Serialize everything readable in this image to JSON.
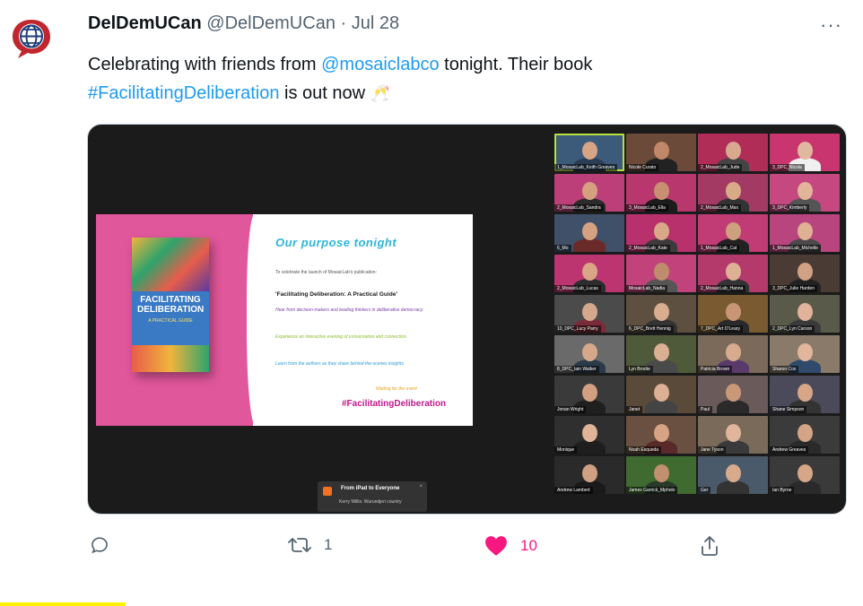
{
  "tweet": {
    "display_name": "DelDemUCan",
    "handle": "@DelDemUCan",
    "separator": "·",
    "date": "Jul 28",
    "more_label": "···",
    "text_1": "Celebrating with friends from ",
    "mention": "@mosaiclabco",
    "text_2": " tonight. Their book",
    "hashtag": "#FacilitatingDeliberation",
    "text_3": " is out now ",
    "emoji": "🥂"
  },
  "avatar": {
    "icon": "globe-speech-bubble-icon",
    "color": "#c0262e"
  },
  "media": {
    "slide": {
      "title": "Our purpose tonight",
      "line_1": "To celebrate the launch of MosaicLab's publication:",
      "main": "'Facilitating Deliberation: A Practical Guide'",
      "line_2": "Hear from decision-makers and leading thinkers in deliberative democracy.",
      "line_3": "Experience an interactive evening of conversation and connection.",
      "line_4": "Learn from the authors as they share behind-the-scenes insights.",
      "waiting": "Waiting for the event",
      "hashtag": "#FacilitatingDeliberation",
      "book_title": "FACILITATING DELIBERATION",
      "book_subtitle": "A PRACTICAL GUIDE"
    },
    "participants": [
      {
        "label": "1_MosaicLab_Keith Greaves",
        "bg": "#3c5a7a",
        "skin": "#d7a486",
        "shirt": "#2a3d55"
      },
      {
        "label": "Nicole Curato",
        "bg": "#6b4a3a",
        "skin": "#c08868",
        "shirt": "#222222"
      },
      {
        "label": "2_MosaicLab_Jude",
        "bg": "#b02d58",
        "skin": "#d8a890",
        "shirt": "#444444"
      },
      {
        "label": "3_DPC_Nicola",
        "bg": "#c9356e",
        "skin": "#e0b8a0",
        "shirt": "#f0f0f0"
      },
      {
        "label": "2_MosaicLab_Sandra",
        "bg": "#bd3f7a",
        "skin": "#d6a080",
        "shirt": "#2b2b2b"
      },
      {
        "label": "3_MosaicLab_Ella",
        "bg": "#b8386e",
        "skin": "#c98f72",
        "shirt": "#1c1c1c"
      },
      {
        "label": "2_MosaicLab_Max",
        "bg": "#a33a63",
        "skin": "#d9aa88",
        "shirt": "#333333"
      },
      {
        "label": "3_DPC_Kimberly",
        "bg": "#c64880",
        "skin": "#e2b49a",
        "shirt": "#555555"
      },
      {
        "label": "6_Mo",
        "bg": "#3f5068",
        "skin": "#d4a283",
        "shirt": "#6b2a2a"
      },
      {
        "label": "2_MosaicLab_Kate",
        "bg": "#b9316c",
        "skin": "#d8a888",
        "shirt": "#3b3b3b"
      },
      {
        "label": "1_MosaicLab_Cat",
        "bg": "#c13b75",
        "skin": "#cfa080",
        "shirt": "#222222"
      },
      {
        "label": "1_MosaicLab_Michelle",
        "bg": "#b8457e",
        "skin": "#e0b095",
        "shirt": "#4a4a4a"
      },
      {
        "label": "2_MosaicLab_Lucas",
        "bg": "#bc3571",
        "skin": "#d9a586",
        "shirt": "#2d2d2d"
      },
      {
        "label": "MosaicLab_Nadia",
        "bg": "#c2437b",
        "skin": "#c08c6e",
        "shirt": "#555555"
      },
      {
        "label": "2_MosaicLab_Hanna",
        "bg": "#b33a6a",
        "skin": "#deb197",
        "shirt": "#333333"
      },
      {
        "label": "3_DPC_Julie Harden",
        "bg": "#4a3b34",
        "skin": "#d1a184",
        "shirt": "#222222"
      },
      {
        "label": "10_DPC_Lucy Parry",
        "bg": "#4b4b4b",
        "skin": "#d4a88c",
        "shirt": "#7a2b3a"
      },
      {
        "label": "6_DPC_Brett Hennig",
        "bg": "#5e5040",
        "skin": "#d9ad90",
        "shirt": "#333333"
      },
      {
        "label": "7_DPC_Art O'Leary",
        "bg": "#7a5a30",
        "skin": "#c89676",
        "shirt": "#2a2a2a"
      },
      {
        "label": "2_DPC_Lyn Carson",
        "bg": "#5a5a4a",
        "skin": "#e0b49a",
        "shirt": "#3a3a3a"
      },
      {
        "label": "8_DPC_Iain Walker",
        "bg": "#6a6a6a",
        "skin": "#d5a88a",
        "shirt": "#2b3a4a"
      },
      {
        "label": "Lyn Brodie",
        "bg": "#4f5a3a",
        "skin": "#dab094",
        "shirt": "#4a4a4a"
      },
      {
        "label": "Patricia Brown",
        "bg": "#7b6a5a",
        "skin": "#d8aa8e",
        "shirt": "#5a3a6a"
      },
      {
        "label": "Sharon Cox",
        "bg": "#8a7a6a",
        "skin": "#e1b69c",
        "shirt": "#2f4a6a"
      },
      {
        "label": "Jonan Wright",
        "bg": "#3a3a3a",
        "skin": "#d2a080",
        "shirt": "#1f1f1f"
      },
      {
        "label": "Janet",
        "bg": "#5a4a3a",
        "skin": "#dbb094",
        "shirt": "#444444"
      },
      {
        "label": "Paul",
        "bg": "#6a5a5a",
        "skin": "#c99878",
        "shirt": "#2a2a2a"
      },
      {
        "label": "Shane Simpson",
        "bg": "#4a4a5a",
        "skin": "#d7a688",
        "shirt": "#333333"
      },
      {
        "label": "Monique",
        "bg": "#2f2f2f",
        "skin": "#e0b498",
        "shirt": "#1e1e1e"
      },
      {
        "label": "Noah Esqueda",
        "bg": "#6a5040",
        "skin": "#d6a484",
        "shirt": "#5a2a2a"
      },
      {
        "label": "Jane Tyson",
        "bg": "#7a6a5a",
        "skin": "#e0b59b",
        "shirt": "#3a3a3a"
      },
      {
        "label": "Andrew Greaves",
        "bg": "#3b3b3b",
        "skin": "#d3a486",
        "shirt": "#2a2a2a"
      },
      {
        "label": "Andrew Lambert",
        "bg": "#2a2a2a",
        "skin": "#d0a082",
        "shirt": "#1a1a1a"
      },
      {
        "label": "James Garrick_Mpholo",
        "bg": "#3f6a30",
        "skin": "#c09070",
        "shirt": "#2a3a2a"
      },
      {
        "label": "Ger",
        "bg": "#4a5a6a",
        "skin": "#d8aa8c",
        "shirt": "#333333"
      },
      {
        "label": "Ian Byrne",
        "bg": "#3a3a3a",
        "skin": "#d5a688",
        "shirt": "#2a2a2a"
      }
    ],
    "chat": {
      "title": "From iPad to Everyone",
      "message": "Kerry Willis: Wurundjeri country",
      "close": "×"
    }
  },
  "actions": {
    "reply": {
      "icon": "reply-icon",
      "count": ""
    },
    "retweet": {
      "icon": "retweet-icon",
      "count": "1"
    },
    "like": {
      "icon": "heart-icon",
      "count": "10",
      "color": "#f91880"
    },
    "share": {
      "icon": "share-icon",
      "count": ""
    }
  }
}
